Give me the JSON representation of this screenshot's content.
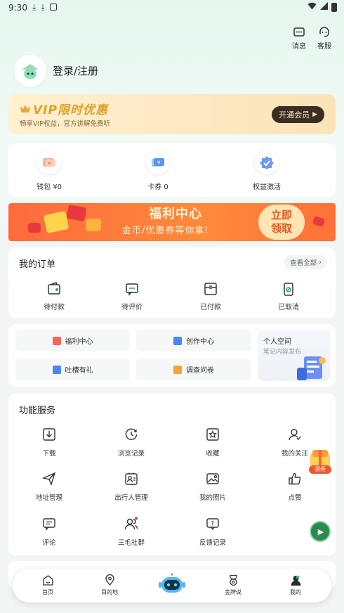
{
  "status_bar": {
    "time": "9:30"
  },
  "header": {
    "messages_label": "消息",
    "service_label": "客服"
  },
  "profile": {
    "login_text": "登录/注册"
  },
  "vip": {
    "title": "VIP限时优惠",
    "subtitle": "畅享VIP权益，官方讲解免费听",
    "button_label": "开通会员"
  },
  "wallet": {
    "items": [
      {
        "label": "钱包 ¥0",
        "icon": "wallet-icon"
      },
      {
        "label": "卡券 0",
        "icon": "coupon-icon"
      },
      {
        "label": "权益激活",
        "icon": "activate-icon"
      }
    ]
  },
  "banner": {
    "title": "福利中心",
    "subtitle": "金币/优惠券等你拿!",
    "cta_line1": "立即",
    "cta_line2": "领取"
  },
  "orders": {
    "title": "我的订单",
    "see_all": "查看全部",
    "items": [
      {
        "label": "待付款",
        "icon": "wallet-pending-icon"
      },
      {
        "label": "待评价",
        "icon": "comment-pending-icon"
      },
      {
        "label": "已付款",
        "icon": "paid-icon"
      },
      {
        "label": "已取消",
        "icon": "cancelled-icon"
      }
    ]
  },
  "quick": {
    "items": [
      {
        "label": "福利中心",
        "icon": "gift-icon",
        "color": "#f2685a"
      },
      {
        "label": "创作中心",
        "icon": "create-icon",
        "color": "#4a86ef"
      },
      {
        "label": "吐槽有礼",
        "icon": "feedback-icon",
        "color": "#4a86ef"
      },
      {
        "label": "调查问卷",
        "icon": "survey-icon",
        "color": "#f5a23a"
      }
    ],
    "space_title": "个人空间",
    "space_subtitle": "笔记内容发布"
  },
  "services": {
    "title": "功能服务",
    "items": [
      {
        "label": "下载",
        "icon": "download-icon"
      },
      {
        "label": "浏览记录",
        "icon": "history-icon"
      },
      {
        "label": "收藏",
        "icon": "favorite-icon"
      },
      {
        "label": "我的关注",
        "icon": "follow-icon"
      },
      {
        "label": "地址管理",
        "icon": "address-icon"
      },
      {
        "label": "出行人管理",
        "icon": "traveler-icon"
      },
      {
        "label": "我的照片",
        "icon": "photo-icon"
      },
      {
        "label": "点赞",
        "icon": "like-icon"
      },
      {
        "label": "评论",
        "icon": "comment-icon"
      },
      {
        "label": "三毛社群",
        "icon": "community-icon"
      },
      {
        "label": "反馈记录",
        "icon": "feedback-record-icon"
      }
    ]
  },
  "float_gift_label": "领券",
  "tabbar": {
    "items": [
      {
        "label": "首页",
        "icon": "home-icon"
      },
      {
        "label": "目的地",
        "icon": "destination-icon"
      },
      {
        "label": "",
        "icon": "robot-icon"
      },
      {
        "label": "金牌说",
        "icon": "medal-icon"
      },
      {
        "label": "我的",
        "icon": "profile-icon"
      }
    ]
  },
  "colors": {
    "brand_green": "#2fa46a",
    "vip_gold": "#e0a02a",
    "banner_orange": "#ff6a3d"
  }
}
